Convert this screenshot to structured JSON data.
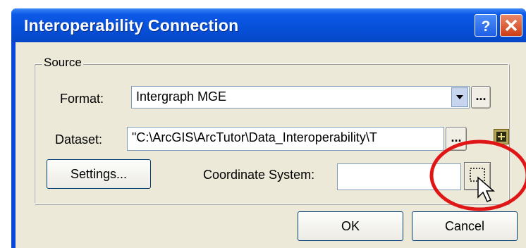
{
  "window": {
    "title": "Interoperability Connection",
    "help_label": "?",
    "close_label": "X"
  },
  "source": {
    "legend": "Source",
    "format_label": "Format:",
    "format_value": "Intergraph MGE",
    "format_browse_label": "...",
    "dataset_label": "Dataset:",
    "dataset_value": "\"C:\\ArcGIS\\ArcTutor\\Data_Interoperability\\T",
    "dataset_browse_label": "...",
    "dataset_add_icon": "plus-icon"
  },
  "settings_button_label": "Settings...",
  "coordinate_system": {
    "label": "Coordinate System:",
    "value": "",
    "button_icon": "dotted-box-icon"
  },
  "buttons": {
    "ok_label": "OK",
    "cancel_label": "Cancel"
  },
  "annotation": {
    "highlight_color": "#e01616",
    "cursor_icon": "arrow-cursor-icon"
  }
}
